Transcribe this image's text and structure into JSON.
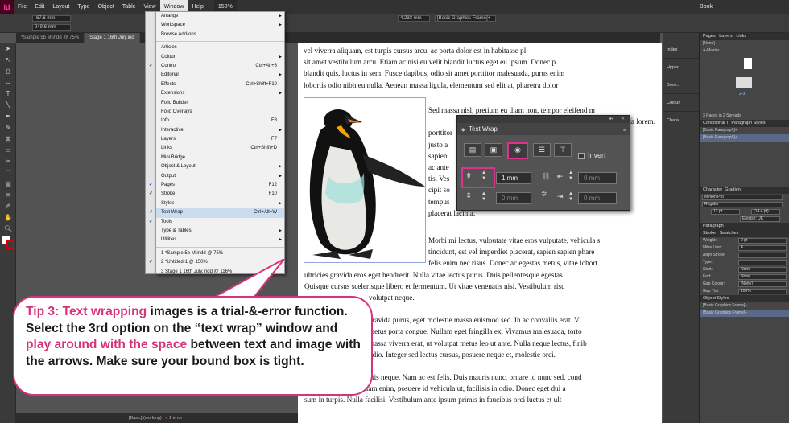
{
  "menubar": {
    "logo": "Id",
    "items": [
      "File",
      "Edit",
      "Layout",
      "Type",
      "Object",
      "Table",
      "View",
      "Window",
      "Help"
    ],
    "zoom": "150%",
    "workspace": "Book"
  },
  "controlbar": {
    "x": "-67.6 mm",
    "y": "249.6 mm",
    "w": "4.233 mm",
    "style": "[Basic Graphics Frame]+"
  },
  "tabs": [
    "*Sample 5b M.indd @ 75%",
    "Stage 1 16th July.ind"
  ],
  "window_menu": {
    "items": [
      {
        "label": "Arrange",
        "shortcut": "",
        "submenu": true,
        "checked": false
      },
      {
        "label": "Workspace",
        "shortcut": "",
        "submenu": true,
        "checked": false
      },
      {
        "label": "Browse Add-ons",
        "shortcut": "",
        "submenu": false,
        "checked": false
      },
      {
        "sep": true
      },
      {
        "label": "Articles",
        "shortcut": "",
        "submenu": false,
        "checked": false
      },
      {
        "label": "Colour",
        "shortcut": "",
        "submenu": true,
        "checked": false
      },
      {
        "label": "Control",
        "shortcut": "Ctrl+Alt+6",
        "submenu": false,
        "checked": true
      },
      {
        "label": "Editorial",
        "shortcut": "",
        "submenu": true,
        "checked": false
      },
      {
        "label": "Effects",
        "shortcut": "Ctrl+Shift+F10",
        "submenu": false,
        "checked": false
      },
      {
        "label": "Extensions",
        "shortcut": "",
        "submenu": true,
        "checked": false
      },
      {
        "label": "Folio Builder",
        "shortcut": "",
        "submenu": false,
        "checked": false
      },
      {
        "label": "Folio Overlays",
        "shortcut": "",
        "submenu": false,
        "checked": false
      },
      {
        "label": "Info",
        "shortcut": "F8",
        "submenu": false,
        "checked": false
      },
      {
        "label": "Interactive",
        "shortcut": "",
        "submenu": true,
        "checked": false
      },
      {
        "label": "Layers",
        "shortcut": "F7",
        "submenu": false,
        "checked": false
      },
      {
        "label": "Links",
        "shortcut": "Ctrl+Shift+D",
        "submenu": false,
        "checked": false
      },
      {
        "label": "Mini Bridge",
        "shortcut": "",
        "submenu": false,
        "checked": false
      },
      {
        "label": "Object & Layout",
        "shortcut": "",
        "submenu": true,
        "checked": false
      },
      {
        "label": "Output",
        "shortcut": "",
        "submenu": true,
        "checked": false
      },
      {
        "label": "Pages",
        "shortcut": "F12",
        "submenu": false,
        "checked": true
      },
      {
        "label": "Stroke",
        "shortcut": "F10",
        "submenu": false,
        "checked": true
      },
      {
        "label": "Styles",
        "shortcut": "",
        "submenu": true,
        "checked": false
      },
      {
        "label": "Text Wrap",
        "shortcut": "Ctrl+Alt+W",
        "submenu": false,
        "checked": true,
        "highlight": true
      },
      {
        "label": "Tools",
        "shortcut": "",
        "submenu": false,
        "checked": true
      },
      {
        "label": "Type & Tables",
        "shortcut": "",
        "submenu": true,
        "checked": false
      },
      {
        "label": "Utilities",
        "shortcut": "",
        "submenu": true,
        "checked": false
      },
      {
        "sep": true
      },
      {
        "label": "1 *Sample 5b M.indd @ 75%",
        "shortcut": "",
        "submenu": false,
        "checked": false
      },
      {
        "label": "2 *Untitled-1 @ 150%",
        "shortcut": "",
        "submenu": false,
        "checked": true
      },
      {
        "label": "3 Stage 1 16th July.indd @ 116%",
        "shortcut": "",
        "submenu": false,
        "checked": false
      }
    ]
  },
  "text_wrap": {
    "title": "Text Wrap",
    "invert_label": "Invert",
    "top_offset": "1 mm",
    "bottom_offset": "0 mm",
    "left_offset": "0 mm",
    "right_offset": "0 mm"
  },
  "page_text": {
    "top_lines": [
      "vel viverra aliquam, est turpis cursus arcu, ac porta dolor est in habitasse pl",
      "sit amet vestibulum arcu. Etiam ac nisi eu velit blandit luctus eget eu ipsum. Donec p",
      "blandit quis, luctus in sem. Fusce dapibus, odio sit amet porttitor malesuada, purus enim",
      "lobortis odio nibh eu nulla. Aenean massa ligula, elementum sed elit at, pharetra dolor"
    ],
    "wrap_lines": [
      "Sed massa nisl, pretium eu diam non, tempor eleifend m",
      "porta lorem.",
      "porttitor",
      "justo a",
      "sapien",
      "ac ante",
      "tis. Ves",
      "cipit so",
      "tempus",
      "placerat lacinia."
    ],
    "para2_lines": [
      "Morbi mi lectus, vulputate vitae eros vulputate, vehicula s",
      "tincidunt, est vel imperdiet placerat, sapien sapien phare",
      "felis enim nec risus. Donec ac egestas metus, vitae lobort",
      "ultricies gravida eros eget hendrerit. Nulla vitae lectus purus. Duis pellentesque egestas",
      "Quisque cursus scelerisque libero et fermentum. Ut vitae venenatis nisi. Vestibulum risu",
      "volutpat neque."
    ],
    "para3_lines": [
      "gravida purus, eget molestie massa euismod sed. In ac convallis erat. V",
      "metus porta congue. Nullam eget fringilla ex. Vivamus malesuada, torto",
      "massa viverra erat, ut volutpat metus leo ut ante. Nulla neque lectus, finib",
      "odio. Integer sed lectus cursus, posuere neque et, molestie orci."
    ],
    "para4_lines": [
      "atis neque. Nam ac est felis. Duis mauris nunc, ornare id nunc sed, cond",
      "quam. Suspendisse diam enim, posuere id vehicula ut, facilisis in odio. Donec eget dui a",
      "sum in turpis. Nulla facilisi. Vestibulum ante ipsum primis in faucibus orci luctus et ult"
    ]
  },
  "tip": {
    "part1": "Tip 3: Text wrapping",
    "part2": " images is a trial-&-error function. Select the 3rd option on the “text wrap” window and ",
    "part3": "play around with the space",
    "part4": " between text and image with the arrows. Make sure your bound box is tight."
  },
  "icon_strip": [
    "Index",
    "Hyper...",
    "Book...",
    "Colour",
    "Chara..."
  ],
  "right_panel": {
    "tabs": [
      "Pages",
      "Layers",
      "Links"
    ],
    "pages_none": "[None]",
    "master": "A-Master",
    "pages_info": "3 Pages in 2 Spreads",
    "spread_label": "2-3",
    "char_styles_tab": "Conditional T",
    "para_styles_tab": "Paragraph Styles",
    "para_style_current": "[Basic Paragraph]+",
    "para_style_item": "[Basic Paragraph]+",
    "character_tab": "Character",
    "gradient_tab": "Gradient",
    "font": "Minion Pro",
    "font_style": "Regular",
    "font_size": "12 pt",
    "leading": "(14.4 pt)",
    "language": "English: UK",
    "paragraph_tab": "Paragraph",
    "stroke_tab": "Stroke",
    "swatches_tab": "Swatches",
    "stroke_rows": [
      {
        "label": "Weight:",
        "value": "0 pt"
      },
      {
        "label": "Mitre Limit:",
        "value": "4"
      },
      {
        "label": "Align Stroke:",
        "value": ""
      },
      {
        "label": "Type:",
        "value": ""
      },
      {
        "label": "Start:",
        "value": "None"
      },
      {
        "label": "End:",
        "value": "None"
      },
      {
        "label": "Gap Colour:",
        "value": "[None]"
      },
      {
        "label": "Gap Tint:",
        "value": "100%"
      }
    ],
    "object_styles_tab": "Object Styles",
    "object_style_current": "[Basic Graphics Frame]+",
    "object_style_item": "[Basic Graphics Frame]+"
  },
  "status": {
    "preflight": "[Basic] (working)",
    "errors": "1 error"
  },
  "colors": {
    "accent": "#d6337a",
    "menubg": "#f1f1f1",
    "highlight": "#ccdcf0"
  }
}
